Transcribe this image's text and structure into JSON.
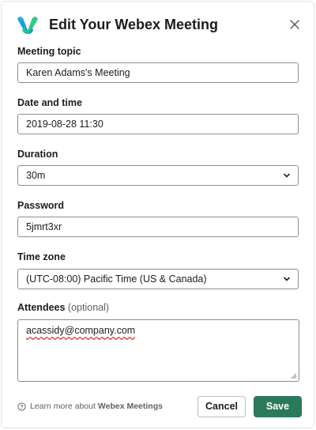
{
  "dialog": {
    "title": "Edit Your Webex Meeting",
    "close_icon": "close-icon",
    "logo_icon": "webex-logo"
  },
  "form": {
    "topic": {
      "label": "Meeting topic",
      "value": "Karen Adams's Meeting"
    },
    "datetime": {
      "label": "Date and time",
      "value": "2019-08-28 11:30"
    },
    "duration": {
      "label": "Duration",
      "value": "30m"
    },
    "password": {
      "label": "Password",
      "value": "5jmrt3xr"
    },
    "timezone": {
      "label": "Time zone",
      "value": "(UTC-08:00) Pacific Time (US & Canada)"
    },
    "attendees": {
      "label": "Attendees",
      "optional": "(optional)",
      "value": "acassidy@company.com"
    }
  },
  "footer": {
    "learn_prefix": "Learn more about",
    "learn_link": "Webex Meetings",
    "cancel_label": "Cancel",
    "save_label": "Save"
  },
  "colors": {
    "save_button": "#2b7a59",
    "field_border": "#8e8e8e",
    "text": "#1d1c1d"
  }
}
